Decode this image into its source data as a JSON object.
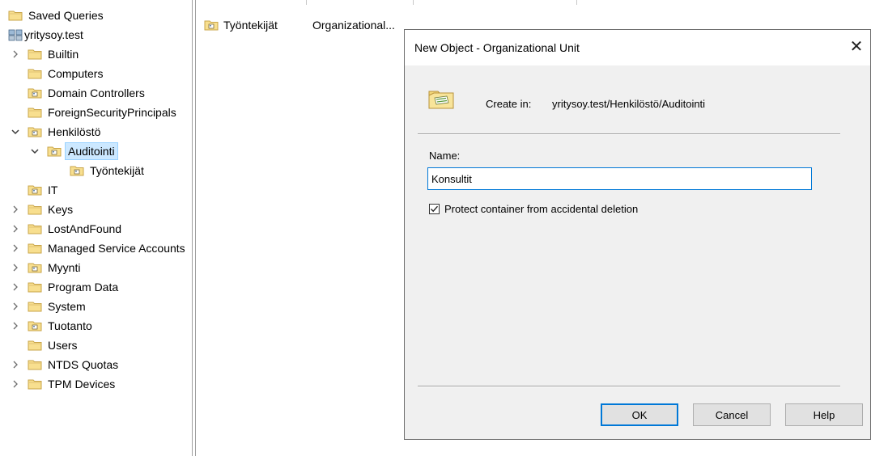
{
  "tree": {
    "items": [
      {
        "label": "Saved Queries",
        "icon": "folder-icon"
      },
      {
        "label": "yritysoy.test",
        "icon": "domain-icon"
      },
      {
        "label": "Builtin",
        "icon": "folder-icon"
      },
      {
        "label": "Computers",
        "icon": "folder-icon"
      },
      {
        "label": "Domain Controllers",
        "icon": "ou-icon"
      },
      {
        "label": "ForeignSecurityPrincipals",
        "icon": "folder-icon"
      },
      {
        "label": "Henkilöstö",
        "icon": "ou-icon"
      },
      {
        "label": "Auditointi",
        "icon": "ou-icon"
      },
      {
        "label": "Työntekijät",
        "icon": "ou-icon"
      },
      {
        "label": "IT",
        "icon": "ou-icon"
      },
      {
        "label": "Keys",
        "icon": "folder-icon"
      },
      {
        "label": "LostAndFound",
        "icon": "folder-icon"
      },
      {
        "label": "Managed Service Accounts",
        "icon": "folder-icon"
      },
      {
        "label": "Myynti",
        "icon": "ou-icon"
      },
      {
        "label": "Program Data",
        "icon": "folder-icon"
      },
      {
        "label": "System",
        "icon": "folder-icon"
      },
      {
        "label": "Tuotanto",
        "icon": "ou-icon"
      },
      {
        "label": "Users",
        "icon": "folder-icon"
      },
      {
        "label": "NTDS Quotas",
        "icon": "folder-icon"
      },
      {
        "label": "TPM Devices",
        "icon": "folder-icon"
      }
    ]
  },
  "list": {
    "rows": [
      {
        "name": "Työntekijät",
        "type": "Organizational..."
      }
    ]
  },
  "dialog": {
    "title": "New Object - Organizational Unit",
    "create_in_label": "Create in:",
    "create_in_value": "yritysoy.test/Henkilöstö/Auditointi",
    "name_label": "Name:",
    "name_value": "Konsultit",
    "protect_label": "Protect container from accidental deletion",
    "protect_checked": true,
    "ok_label": "OK",
    "cancel_label": "Cancel",
    "help_label": "Help"
  },
  "colors": {
    "selection_bg": "#cce8ff",
    "selection_border": "#99d1ff",
    "dialog_bg": "#f0f0f0",
    "focus_blue": "#0078d7",
    "folder_yellow": "#f3d77a"
  }
}
